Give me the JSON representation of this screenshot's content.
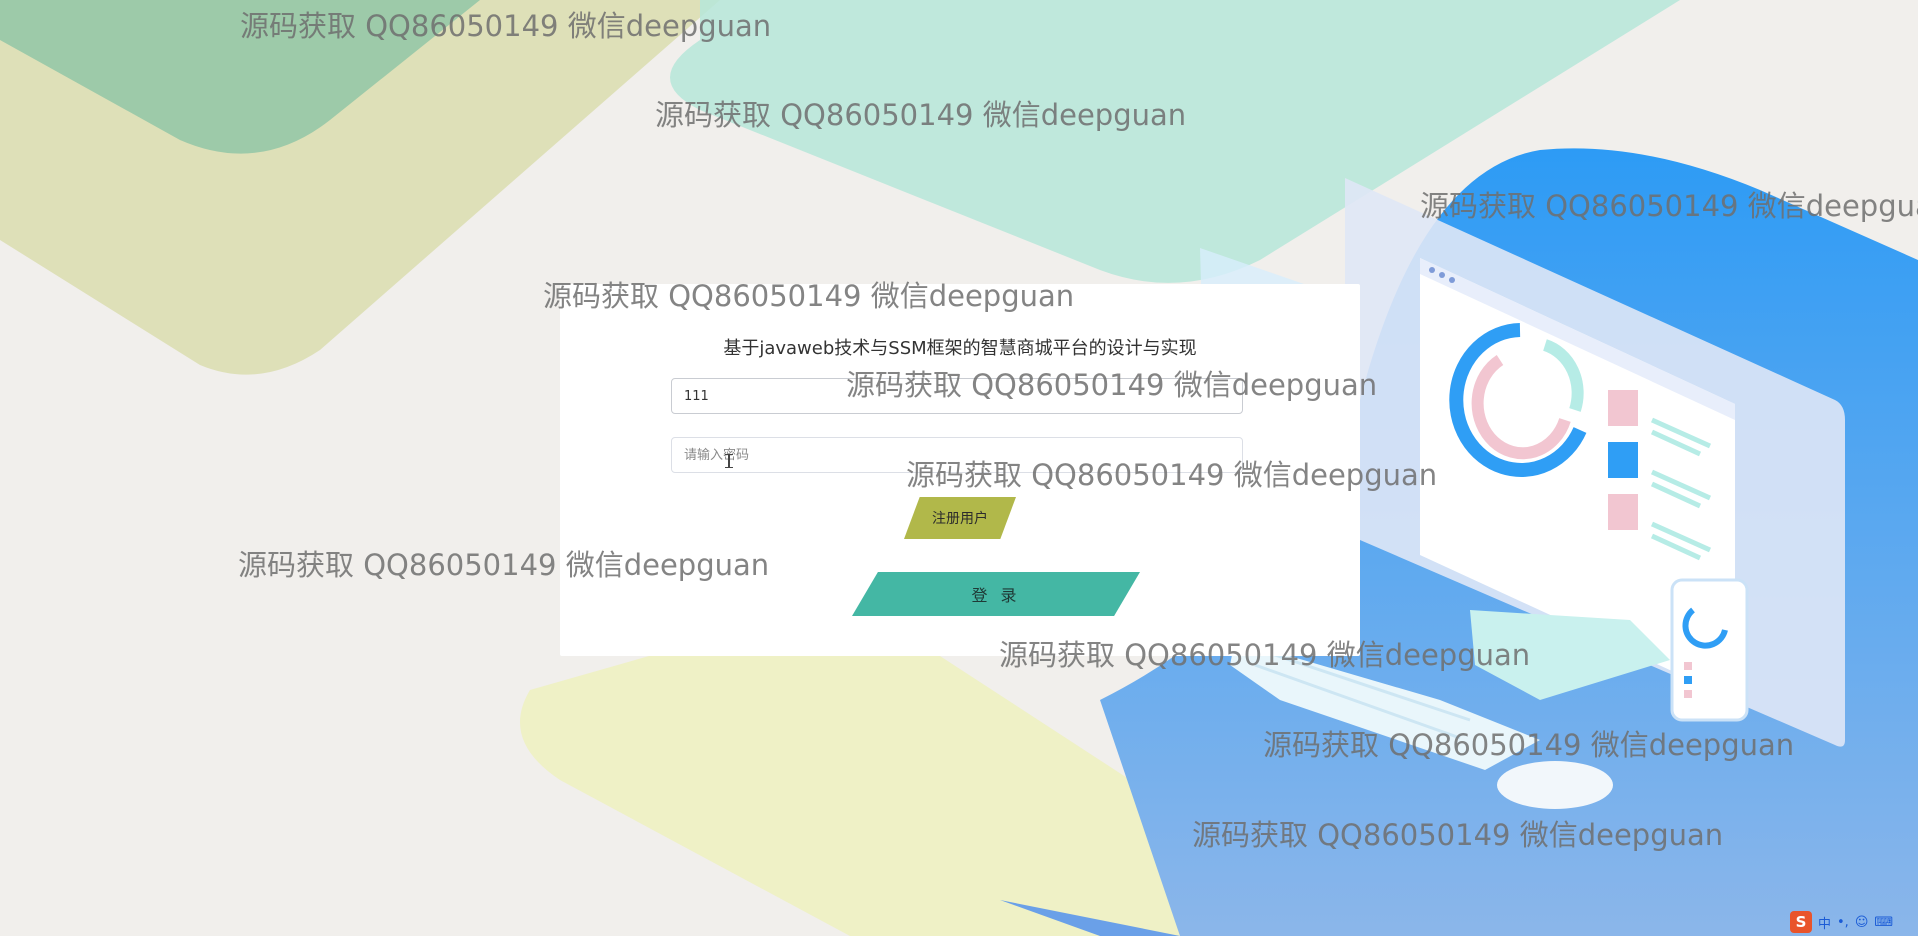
{
  "page": {
    "title": "基于javaweb技术与SSM框架的智慧商城平台的设计与实现"
  },
  "login_form": {
    "username_value": "111",
    "username_placeholder": "",
    "password_placeholder": "请输入密码",
    "register_label": "注册用户",
    "login_label": "登 录"
  },
  "watermark": {
    "text": "源码获取 QQ86050149 微信deepguan"
  },
  "ime_toolbar": {
    "logo": "S",
    "mode_label": "中",
    "punct_label": "•,",
    "emoji_icon": "smile-icon",
    "keyboard_icon": "keyboard-icon"
  },
  "colors": {
    "register_button": "#b1b84a",
    "login_button": "#44b7a4",
    "monitor_blue": "#2f9ef5"
  }
}
